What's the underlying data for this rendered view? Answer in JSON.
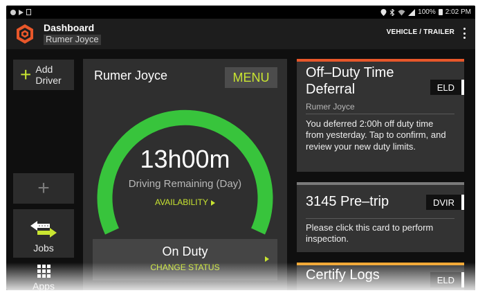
{
  "status_bar": {
    "left_icons": [
      "notification-dot-icon",
      "play-icon",
      "sim-icon"
    ],
    "battery": "100%",
    "time": "2:02 PM"
  },
  "app_bar": {
    "title": "Dashboard",
    "subtitle": "Rumer Joyce",
    "vehicle_trailer": "VEHICLE / TRAILER"
  },
  "left_rail": {
    "add_driver_line1": "Add",
    "add_driver_line2": "Driver",
    "jobs": "Jobs",
    "apps": "Apps"
  },
  "driver_card": {
    "name": "Rumer Joyce",
    "menu": "MENU",
    "time_remaining": "13h00m",
    "remaining_label": "Driving Remaining (Day)",
    "availability": "AVAILABILITY",
    "gauge_fraction": 1.0,
    "gauge_color": "#38c43c",
    "status": "On Duty",
    "change_status": "CHANGE STATUS"
  },
  "cards": [
    {
      "title_line1": "Off–Duty Time",
      "title_line2": "Deferral",
      "badge": "ELD",
      "subtitle": "Rumer Joyce",
      "body": "You deferred 2:00h off duty time from yesterday. Tap to confirm, and review your new duty limits.",
      "accent": "#e8572a"
    },
    {
      "title": "3145 Pre–trip",
      "badge": "DVIR",
      "body": "Please click this card to perform inspection.",
      "accent": "#7a7a7a"
    },
    {
      "title": "Certify Logs",
      "badge": "ELD",
      "accent": "#f0a630"
    }
  ],
  "colors": {
    "accent_green": "#c9e531",
    "gauge_green": "#38c43c"
  }
}
